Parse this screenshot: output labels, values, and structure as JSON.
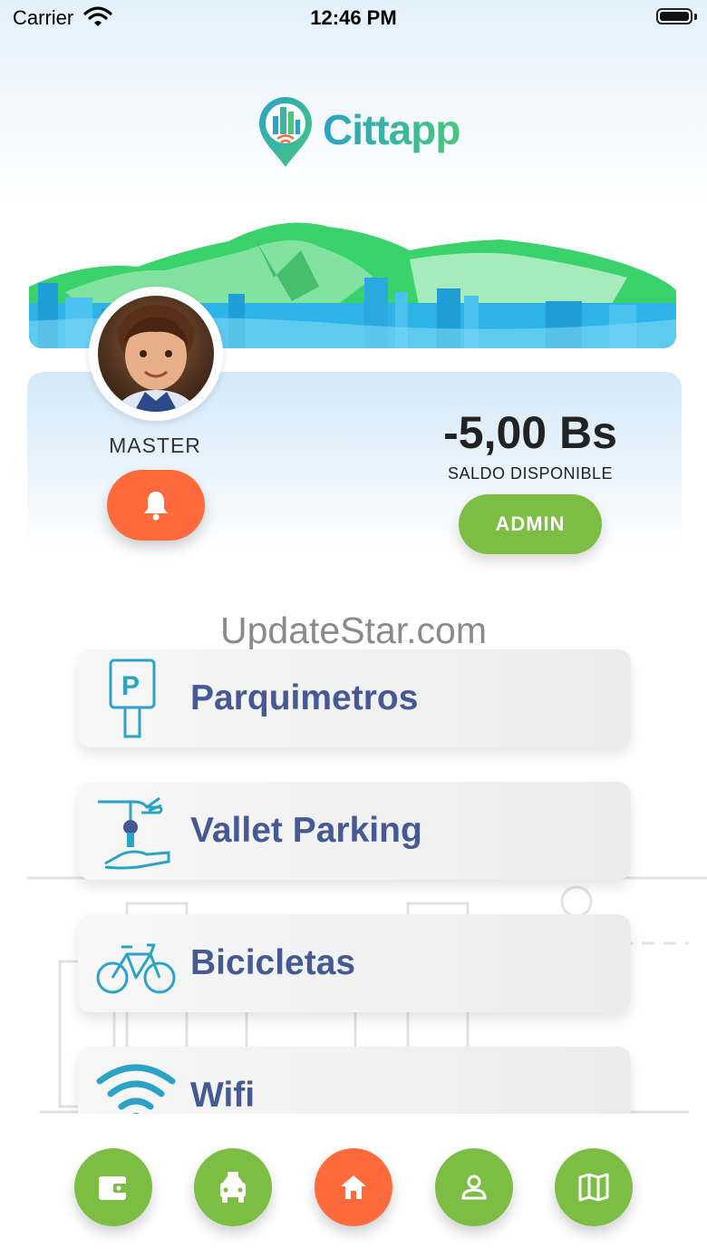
{
  "status_bar": {
    "carrier": "Carrier",
    "time": "12:46 PM"
  },
  "brand": {
    "app_name": "Cittapp",
    "accent_blue": "#2aa3c6",
    "accent_green": "#7cbe43",
    "accent_orange": "#ff6a3d",
    "text_navy": "#455a95"
  },
  "profile": {
    "username": "MASTER"
  },
  "balance": {
    "amount": "-5,00 Bs",
    "label": "SALDO DISPONIBLE",
    "admin_label": "ADMIN"
  },
  "watermark": "UpdateStar.com",
  "menu": [
    {
      "label": "Parquimetros",
      "icon": "parking-meter-icon"
    },
    {
      "label": "Vallet Parking",
      "icon": "valet-key-icon"
    },
    {
      "label": "Bicicletas",
      "icon": "bicycle-icon"
    },
    {
      "label": "Wifi",
      "icon": "wifi-icon"
    }
  ],
  "bottom_nav": [
    {
      "icon": "wallet-icon",
      "active": false
    },
    {
      "icon": "car-icon",
      "active": false
    },
    {
      "icon": "home-icon",
      "active": true
    },
    {
      "icon": "user-icon",
      "active": false
    },
    {
      "icon": "map-icon",
      "active": false
    }
  ]
}
